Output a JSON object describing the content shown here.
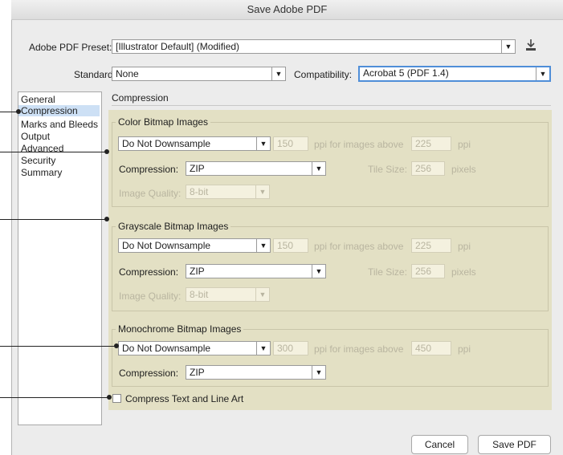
{
  "window": {
    "title": "Save Adobe PDF"
  },
  "preset": {
    "label": "Adobe PDF Preset:",
    "value": "[Illustrator Default] (Modified)",
    "icon": "save-preset-icon"
  },
  "standard": {
    "label": "Standard:",
    "value": "None"
  },
  "compatibility": {
    "label": "Compatibility:",
    "value": "Acrobat 5 (PDF 1.4)"
  },
  "sidebar": {
    "items": [
      {
        "label": "General",
        "selected": false
      },
      {
        "label": "Compression",
        "selected": true
      },
      {
        "label": "Marks and Bleeds",
        "selected": false
      },
      {
        "label": "Output",
        "selected": false
      },
      {
        "label": "Advanced",
        "selected": false
      },
      {
        "label": "Security",
        "selected": false
      },
      {
        "label": "Summary",
        "selected": false
      }
    ]
  },
  "section_title": "Compression",
  "color": {
    "title": "Color Bitmap Images",
    "downsample": "Do Not Downsample",
    "ppi": "150",
    "ppi_above_label": "ppi for images above",
    "ppi_above": "225",
    "ppi_unit": "ppi",
    "compression_label": "Compression:",
    "compression": "ZIP",
    "tile_label": "Tile Size:",
    "tile": "256",
    "tile_unit": "pixels",
    "quality_label": "Image Quality:",
    "quality": "8-bit"
  },
  "grayscale": {
    "title": "Grayscale Bitmap Images",
    "downsample": "Do Not Downsample",
    "ppi": "150",
    "ppi_above_label": "ppi for images above",
    "ppi_above": "225",
    "ppi_unit": "ppi",
    "compression_label": "Compression:",
    "compression": "ZIP",
    "tile_label": "Tile Size:",
    "tile": "256",
    "tile_unit": "pixels",
    "quality_label": "Image Quality:",
    "quality": "8-bit"
  },
  "mono": {
    "title": "Monochrome Bitmap Images",
    "downsample": "Do Not Downsample",
    "ppi": "300",
    "ppi_above_label": "ppi for images above",
    "ppi_above": "450",
    "ppi_unit": "ppi",
    "compression_label": "Compression:",
    "compression": "ZIP"
  },
  "compress_text": {
    "label": "Compress Text and Line Art",
    "checked": false
  },
  "buttons": {
    "cancel": "Cancel",
    "save": "Save PDF"
  },
  "colors": {
    "panel": "#e3e0c4",
    "selection": "#cde0f5",
    "focus": "#4f8ed8"
  }
}
